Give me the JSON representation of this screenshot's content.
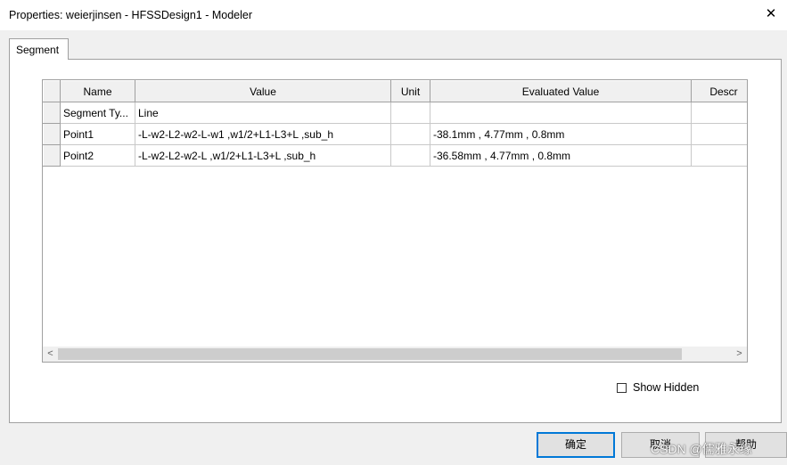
{
  "window": {
    "title": "Properties: weierjinsen - HFSSDesign1 - Modeler",
    "close_symbol": "✕"
  },
  "tab": {
    "label": "Segment"
  },
  "table": {
    "columns": [
      "Name",
      "Value",
      "Unit",
      "Evaluated Value",
      "Descr"
    ],
    "rows": [
      {
        "name": "Segment Ty...",
        "value": "Line",
        "unit": "",
        "evaluated": "",
        "descr": ""
      },
      {
        "name": "Point1",
        "value": "-L-w2-L2-w2-L-w1 ,w1/2+L1-L3+L ,sub_h",
        "unit": "",
        "evaluated": "-38.1mm , 4.77mm , 0.8mm",
        "descr": ""
      },
      {
        "name": "Point2",
        "value": "-L-w2-L2-w2-L ,w1/2+L1-L3+L ,sub_h",
        "unit": "",
        "evaluated": "-36.58mm , 4.77mm , 0.8mm",
        "descr": ""
      }
    ]
  },
  "scrollbar": {
    "left_arrow": "<",
    "right_arrow": ">"
  },
  "show_hidden": {
    "label": "Show Hidden",
    "checked": false
  },
  "buttons": {
    "ok": "确定",
    "cancel": "取消",
    "third": "帮助"
  },
  "watermark": "CSDN @儒雅永缘"
}
